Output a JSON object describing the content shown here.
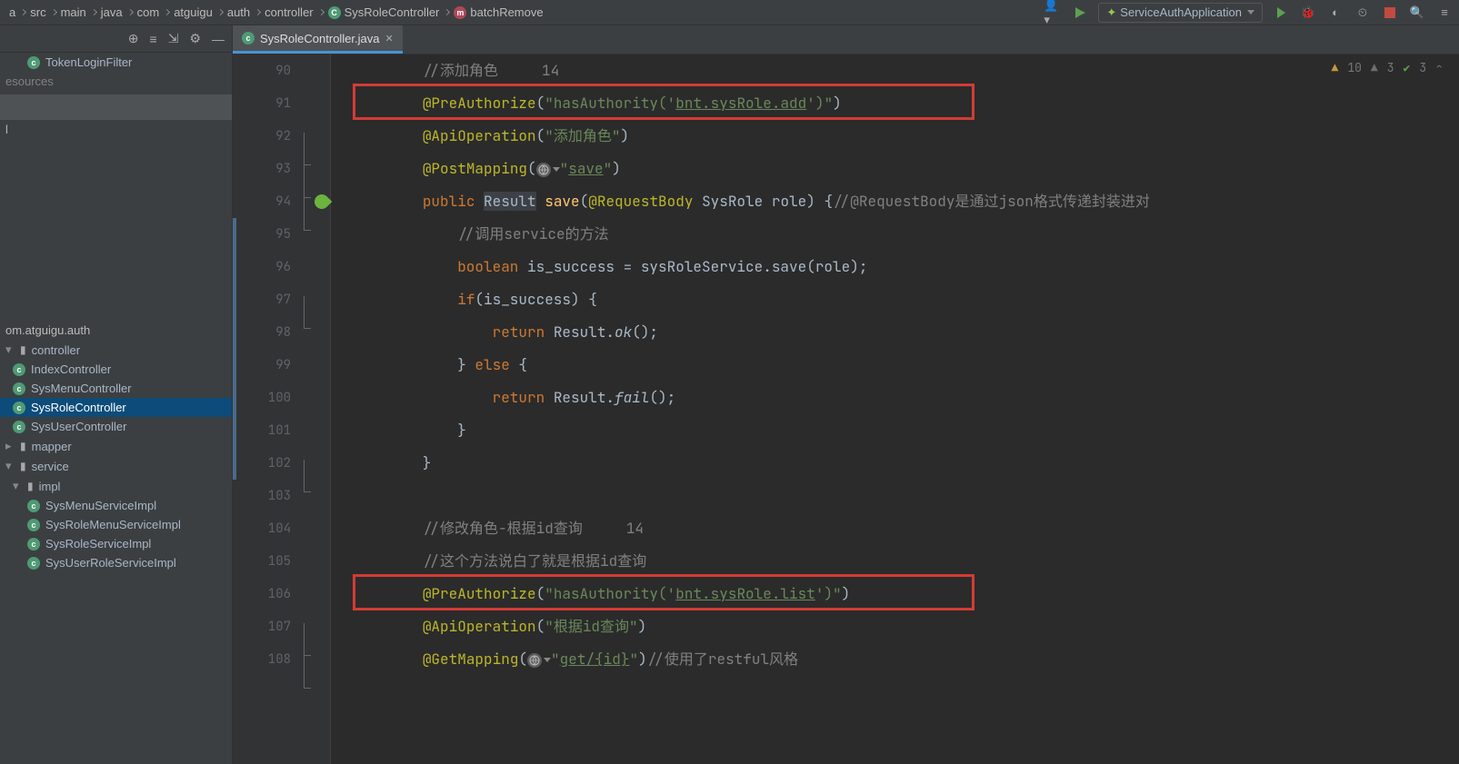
{
  "breadcrumb": {
    "items": [
      "a",
      "src",
      "main",
      "java",
      "com",
      "atguigu",
      "auth",
      "controller"
    ],
    "class_icon": "c",
    "class_name": "SysRoleController",
    "method_icon": "m",
    "method_name": "batchRemove"
  },
  "run_config": {
    "label": "ServiceAuthApplication"
  },
  "sidebar": {
    "top_item": "TokenLoginFilter",
    "resources_label": "esources",
    "l_label": "l",
    "package": "om.atguigu.auth",
    "folders": {
      "controller": "controller",
      "mapper": "mapper",
      "service": "service",
      "impl": "impl"
    },
    "controllers": [
      "IndexController",
      "SysMenuController",
      "SysRoleController",
      "SysUserController"
    ],
    "impls": [
      "SysMenuServiceImpl",
      "SysRoleMenuServiceImpl",
      "SysRoleServiceImpl",
      "SysUserRoleServiceImpl"
    ]
  },
  "tab": {
    "filename": "SysRoleController.java"
  },
  "inspections": {
    "warnings": "10",
    "weak_warnings": "3",
    "typos": "3"
  },
  "code": {
    "lines": [
      {
        "num": "90",
        "tokens": [
          {
            "t": "        ",
            "c": ""
          },
          {
            "t": "//添加角色     14",
            "c": "c-comment"
          }
        ]
      },
      {
        "num": "91",
        "tokens": [
          {
            "t": "        ",
            "c": ""
          },
          {
            "t": "@PreAuthorize",
            "c": "c-annot"
          },
          {
            "t": "(",
            "c": ""
          },
          {
            "t": "\"hasAuthority('",
            "c": "c-string"
          },
          {
            "t": "bnt.sysRole.add",
            "c": "c-link"
          },
          {
            "t": "')\"",
            "c": "c-string"
          },
          {
            "t": ")",
            "c": ""
          }
        ],
        "redbox": true
      },
      {
        "num": "92",
        "tokens": [
          {
            "t": "        ",
            "c": ""
          },
          {
            "t": "@ApiOperation",
            "c": "c-annot"
          },
          {
            "t": "(",
            "c": ""
          },
          {
            "t": "\"添加角色\"",
            "c": "c-string"
          },
          {
            "t": ")",
            "c": ""
          }
        ]
      },
      {
        "num": "93",
        "tokens": [
          {
            "t": "        ",
            "c": ""
          },
          {
            "t": "@PostMapping",
            "c": "c-annot"
          },
          {
            "t": "(",
            "c": ""
          },
          {
            "t": "🌐",
            "c": "globe-icon",
            "raw": true
          },
          {
            "t": "\"",
            "c": "c-string"
          },
          {
            "t": "save",
            "c": "c-string",
            "u": true
          },
          {
            "t": "\"",
            "c": "c-string"
          },
          {
            "t": ")",
            "c": ""
          }
        ]
      },
      {
        "num": "94",
        "spring": true,
        "tokens": [
          {
            "t": "        ",
            "c": ""
          },
          {
            "t": "public ",
            "c": "c-keyword"
          },
          {
            "t": "Result",
            "c": "c-type c-hl"
          },
          {
            "t": " ",
            "c": ""
          },
          {
            "t": "save",
            "c": "c-call"
          },
          {
            "t": "(",
            "c": ""
          },
          {
            "t": "@RequestBody ",
            "c": "c-annot"
          },
          {
            "t": "SysRole role) {",
            "c": ""
          },
          {
            "t": "//@RequestBody是通过json格式传递封装进对",
            "c": "c-comment"
          }
        ]
      },
      {
        "num": "95",
        "tokens": [
          {
            "t": "            ",
            "c": ""
          },
          {
            "t": "//调用service的方法",
            "c": "c-comment"
          }
        ]
      },
      {
        "num": "96",
        "tokens": [
          {
            "t": "            ",
            "c": ""
          },
          {
            "t": "boolean ",
            "c": "c-keyword"
          },
          {
            "t": "is_success = ",
            "c": ""
          },
          {
            "t": "sysRoleService",
            "c": "c-ident"
          },
          {
            "t": ".save(role);",
            "c": ""
          }
        ]
      },
      {
        "num": "97",
        "tokens": [
          {
            "t": "            ",
            "c": ""
          },
          {
            "t": "if",
            "c": "c-keyword"
          },
          {
            "t": "(is_success) {",
            "c": ""
          }
        ]
      },
      {
        "num": "98",
        "tokens": [
          {
            "t": "                ",
            "c": ""
          },
          {
            "t": "return ",
            "c": "c-keyword"
          },
          {
            "t": "Result.",
            "c": ""
          },
          {
            "t": "ok",
            "c": "c-static"
          },
          {
            "t": "();",
            "c": ""
          }
        ]
      },
      {
        "num": "99",
        "tokens": [
          {
            "t": "            } ",
            "c": ""
          },
          {
            "t": "else ",
            "c": "c-keyword"
          },
          {
            "t": "{",
            "c": ""
          }
        ]
      },
      {
        "num": "100",
        "tokens": [
          {
            "t": "                ",
            "c": ""
          },
          {
            "t": "return ",
            "c": "c-keyword"
          },
          {
            "t": "Result.",
            "c": ""
          },
          {
            "t": "fail",
            "c": "c-static"
          },
          {
            "t": "();",
            "c": ""
          }
        ]
      },
      {
        "num": "101",
        "tokens": [
          {
            "t": "            }",
            "c": ""
          }
        ]
      },
      {
        "num": "102",
        "tokens": [
          {
            "t": "        }",
            "c": ""
          }
        ]
      },
      {
        "num": "103",
        "tokens": [
          {
            "t": "",
            "c": ""
          }
        ]
      },
      {
        "num": "104",
        "tokens": [
          {
            "t": "        ",
            "c": ""
          },
          {
            "t": "//修改角色-根据id查询     14",
            "c": "c-comment"
          }
        ]
      },
      {
        "num": "105",
        "tokens": [
          {
            "t": "        ",
            "c": ""
          },
          {
            "t": "//这个方法说白了就是根据id查询",
            "c": "c-comment"
          }
        ]
      },
      {
        "num": "106",
        "tokens": [
          {
            "t": "        ",
            "c": ""
          },
          {
            "t": "@PreAuthorize",
            "c": "c-annot"
          },
          {
            "t": "(",
            "c": ""
          },
          {
            "t": "\"hasAuthority('",
            "c": "c-string"
          },
          {
            "t": "bnt.sysRole.list",
            "c": "c-link"
          },
          {
            "t": "')\"",
            "c": "c-string"
          },
          {
            "t": ")",
            "c": ""
          }
        ],
        "redbox": true
      },
      {
        "num": "107",
        "tokens": [
          {
            "t": "        ",
            "c": ""
          },
          {
            "t": "@ApiOperation",
            "c": "c-annot"
          },
          {
            "t": "(",
            "c": ""
          },
          {
            "t": "\"根据id查询\"",
            "c": "c-string"
          },
          {
            "t": ")",
            "c": ""
          }
        ]
      },
      {
        "num": "108",
        "tokens": [
          {
            "t": "        ",
            "c": ""
          },
          {
            "t": "@GetMapping",
            "c": "c-annot"
          },
          {
            "t": "(",
            "c": ""
          },
          {
            "t": "🌐",
            "c": "globe-icon",
            "raw": true
          },
          {
            "t": "\"",
            "c": "c-string"
          },
          {
            "t": "get/{id}",
            "c": "c-string",
            "u": true
          },
          {
            "t": "\"",
            "c": "c-string"
          },
          {
            "t": ")",
            "c": ""
          },
          {
            "t": "//使用了restful风格",
            "c": "c-comment"
          }
        ]
      }
    ]
  }
}
